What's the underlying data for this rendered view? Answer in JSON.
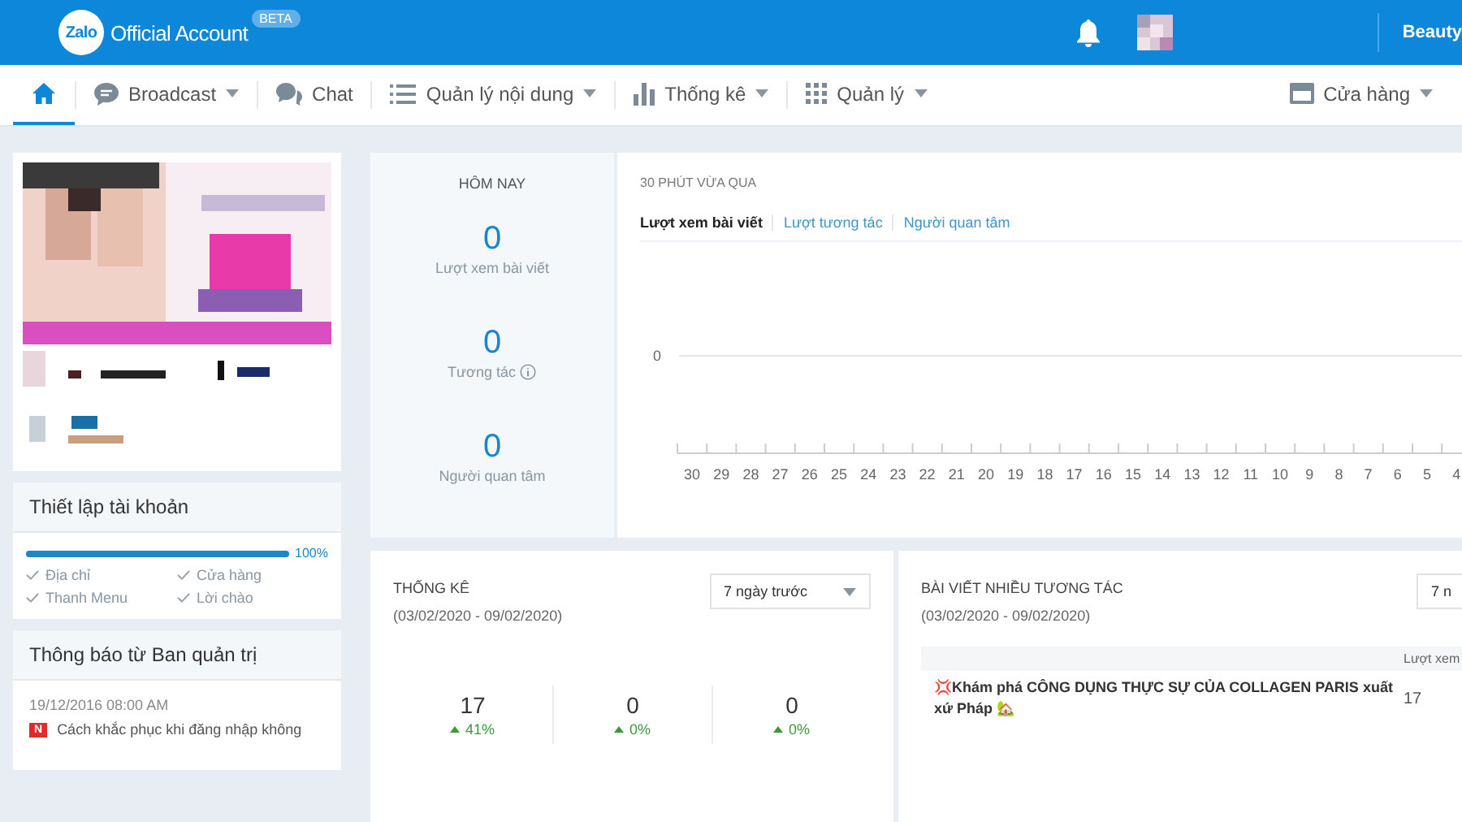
{
  "header": {
    "logo": "Zalo",
    "title": "Official Account",
    "badge": "BETA",
    "account_name": "Beauty"
  },
  "nav": {
    "items": [
      {
        "kind": "home",
        "selected": true,
        "caret": false
      },
      {
        "kind": "broadcast",
        "label": "Broadcast",
        "selected": false,
        "caret": true
      },
      {
        "kind": "chat",
        "label": "Chat",
        "selected": false,
        "caret": false
      },
      {
        "kind": "content",
        "label": "Quản lý nội dung",
        "selected": false,
        "caret": true
      },
      {
        "kind": "stats",
        "label": "Thống kê",
        "selected": false,
        "caret": true
      },
      {
        "kind": "manage",
        "label": "Quản lý",
        "selected": false,
        "caret": true
      }
    ],
    "store": {
      "label": "Cửa hàng",
      "caret": true
    }
  },
  "setup": {
    "title": "Thiết lập tài khoản",
    "level": 1,
    "percent": "100%",
    "items": [
      {
        "label": "Địa chỉ",
        "checked": true
      },
      {
        "label": "Cửa hàng",
        "checked": true
      },
      {
        "label": "Thanh Menu",
        "checked": true
      },
      {
        "label": "Lời chào",
        "checked": true
      }
    ]
  },
  "notices": {
    "title": "Thông báo từ Ban quản trị",
    "items": [
      {
        "date": "19/12/2016 08:00 AM",
        "tag": "N",
        "text": "Cách khắc phục khi đăng nhập không"
      }
    ]
  },
  "today": {
    "title": "HÔM NAY",
    "metrics": [
      {
        "value": "0",
        "label": "Lượt xem bài viết",
        "info": false
      },
      {
        "value": "0",
        "label": "Tương tác",
        "info": true
      },
      {
        "value": "0",
        "label": "Người quan tâm",
        "info": false
      }
    ]
  },
  "recent": {
    "title": "30 PHÚT VỪA QUA",
    "tabs": [
      {
        "label": "Lượt xem bài viết",
        "selected": true
      },
      {
        "label": "Lượt tương tác",
        "selected": false
      },
      {
        "label": "Người quan tâm",
        "selected": false
      }
    ],
    "y_label": "0",
    "x_labels": [
      "30",
      "29",
      "28",
      "27",
      "26",
      "25",
      "24",
      "23",
      "22",
      "21",
      "20",
      "19",
      "18",
      "17",
      "16",
      "15",
      "14",
      "13",
      "12",
      "11",
      "10",
      "9",
      "8",
      "7",
      "6",
      "5",
      "4"
    ]
  },
  "stats": {
    "title": "THỐNG KÊ",
    "range": "(03/02/2020 - 09/02/2020)",
    "period": "7 ngày trước",
    "figures": [
      {
        "value": "17",
        "change": "41%"
      },
      {
        "value": "0",
        "change": "0%"
      },
      {
        "value": "0",
        "change": "0%"
      }
    ]
  },
  "posts": {
    "title": "BÀI VIẾT NHIỀU TƯƠNG TÁC",
    "range": "(03/02/2020 - 09/02/2020)",
    "period": "7 n",
    "column": "Lượt xem",
    "rows": [
      {
        "title": "💢Khám phá CÔNG DỤNG THỰC SỰ CỦA COLLAGEN PARIS xuất xứ Pháp 🏡",
        "views": "17"
      }
    ]
  }
}
